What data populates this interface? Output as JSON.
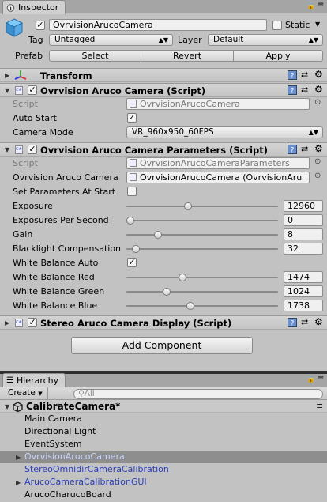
{
  "inspector": {
    "tab_label": "Inspector",
    "object_name": "OvrvisionArucoCamera",
    "static_label": "Static",
    "tag_label": "Tag",
    "tag_value": "Untagged",
    "layer_label": "Layer",
    "layer_value": "Default",
    "prefab_label": "Prefab",
    "prefab_select": "Select",
    "prefab_revert": "Revert",
    "prefab_apply": "Apply"
  },
  "transform": {
    "title": "Transform"
  },
  "aruco_camera": {
    "title": "Ovrvision Aruco Camera (Script)",
    "script_label": "Script",
    "script_value": "OvrvisionArucoCamera",
    "auto_start_label": "Auto Start",
    "camera_mode_label": "Camera Mode",
    "camera_mode_value": "VR_960x950_60FPS"
  },
  "params": {
    "title": "Ovrvision Aruco Camera Parameters (Script)",
    "script_label": "Script",
    "script_value": "OvrvisionArucoCameraParameters",
    "ref_label": "Ovrvision Aruco Camera",
    "ref_value": "OvrvisionArucoCamera (OvrvisionAru",
    "set_params_label": "Set Parameters At Start",
    "sliders": [
      {
        "label": "Exposure",
        "value": "12960",
        "fraction": 0.4
      },
      {
        "label": "Exposures Per Second",
        "value": "0",
        "fraction": 0.0
      },
      {
        "label": "Gain",
        "value": "8",
        "fraction": 0.19
      },
      {
        "label": "Blacklight Compensation",
        "value": "32",
        "fraction": 0.04
      }
    ],
    "wb_auto_label": "White Balance Auto",
    "wb_sliders": [
      {
        "label": "White Balance Red",
        "value": "1474",
        "fraction": 0.36
      },
      {
        "label": "White Balance Green",
        "value": "1024",
        "fraction": 0.25
      },
      {
        "label": "White Balance Blue",
        "value": "1738",
        "fraction": 0.42
      }
    ]
  },
  "stereo": {
    "title": "Stereo Aruco Camera Display (Script)"
  },
  "add_component": "Add Component",
  "hierarchy": {
    "tab_label": "Hierarchy",
    "create_label": "Create",
    "search_placeholder": "All",
    "scene_name": "CalibrateCamera*",
    "items": [
      {
        "label": "Main Camera"
      },
      {
        "label": "Directional Light"
      },
      {
        "label": "EventSystem"
      },
      {
        "label": "OvrvisionArucoCamera"
      },
      {
        "label": "StereoOmnidirCameraCalibration"
      },
      {
        "label": "ArucoCameraCalibrationGUI"
      },
      {
        "label": "ArucoCharucoBoard"
      }
    ]
  },
  "colors": {
    "accent_blue": "#2b3fb8",
    "selected_row": "#8e8e8e",
    "panel_bg": "#c2c2c2"
  }
}
